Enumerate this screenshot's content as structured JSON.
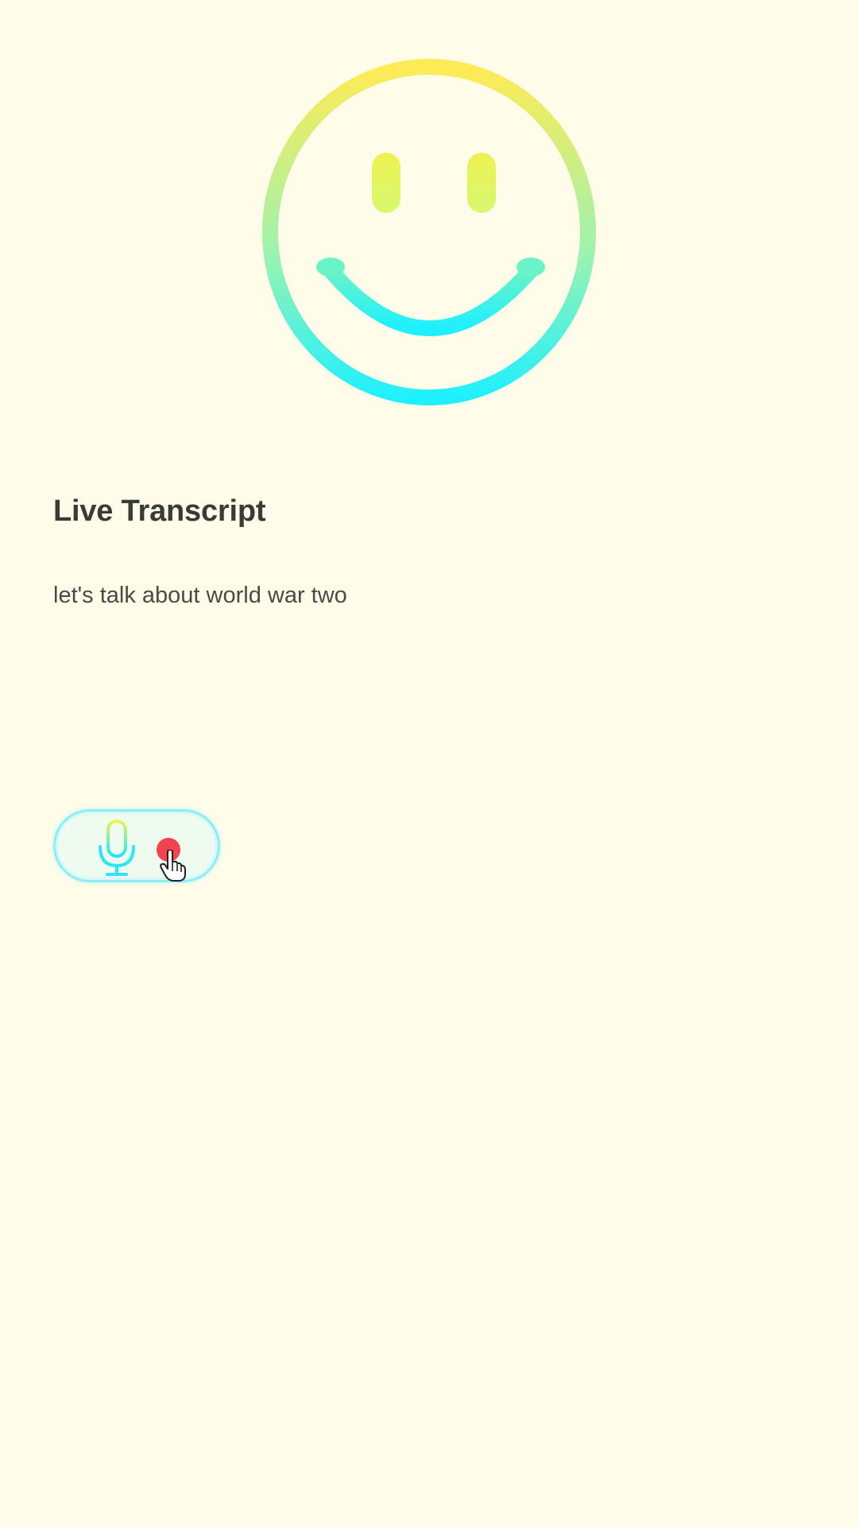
{
  "avatar": {
    "icon": "smiley-face-icon",
    "gradient_top": "#ffeb55",
    "gradient_bottom": "#1ef0ff"
  },
  "transcript": {
    "heading": "Live Transcript",
    "text": "let's talk about world war two"
  },
  "record_button": {
    "mic_icon": "microphone-icon",
    "status_icon": "recording-dot-icon",
    "recording_color": "#f2434f",
    "border_color": "#8bf0f6"
  },
  "colors": {
    "background": "#fffdea",
    "text": "#3a3a36"
  }
}
